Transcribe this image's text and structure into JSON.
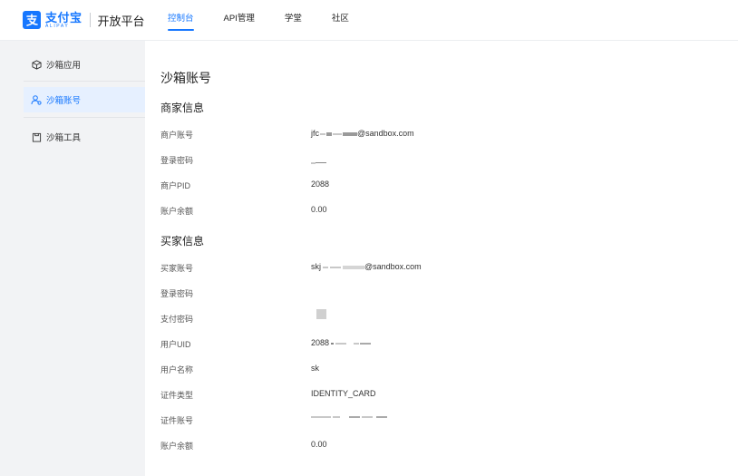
{
  "header": {
    "brand_cn": "支付宝",
    "brand_en": "ALIPAY",
    "platform": "开放平台",
    "nav": [
      {
        "label": "控制台",
        "active": true
      },
      {
        "label": "API管理",
        "active": false
      },
      {
        "label": "学堂",
        "active": false
      },
      {
        "label": "社区",
        "active": false
      }
    ]
  },
  "sidebar": {
    "items": [
      {
        "label": "沙箱应用",
        "icon": "cube-icon",
        "active": false
      },
      {
        "label": "沙箱账号",
        "icon": "users-icon",
        "active": true
      },
      {
        "label": "沙箱工具",
        "icon": "clipboard-icon",
        "active": false
      }
    ]
  },
  "main": {
    "title": "沙箱账号",
    "merchant": {
      "section_title": "商家信息",
      "account_label": "商户账号",
      "account_prefix": "jfc",
      "account_suffix": "@sandbox.com",
      "password_label": "登录密码",
      "pid_label": "商户PID",
      "pid_value": "2088",
      "balance_label": "账户余额",
      "balance_value": "0.00"
    },
    "buyer": {
      "section_title": "买家信息",
      "account_label": "买家账号",
      "account_prefix": "skj",
      "account_suffix": "@sandbox.com",
      "login_password_label": "登录密码",
      "pay_password_label": "支付密码",
      "uid_label": "用户UID",
      "uid_value": "2088",
      "name_label": "用户名称",
      "name_value": "sk",
      "id_type_label": "证件类型",
      "id_type_value": "IDENTITY_CARD",
      "id_number_label": "证件账号",
      "balance_label": "账户余额",
      "balance_value": "0.00"
    }
  },
  "colors": {
    "accent": "#1677ff",
    "active_bg": "#e6f0ff",
    "page_bg": "#f2f3f5"
  }
}
